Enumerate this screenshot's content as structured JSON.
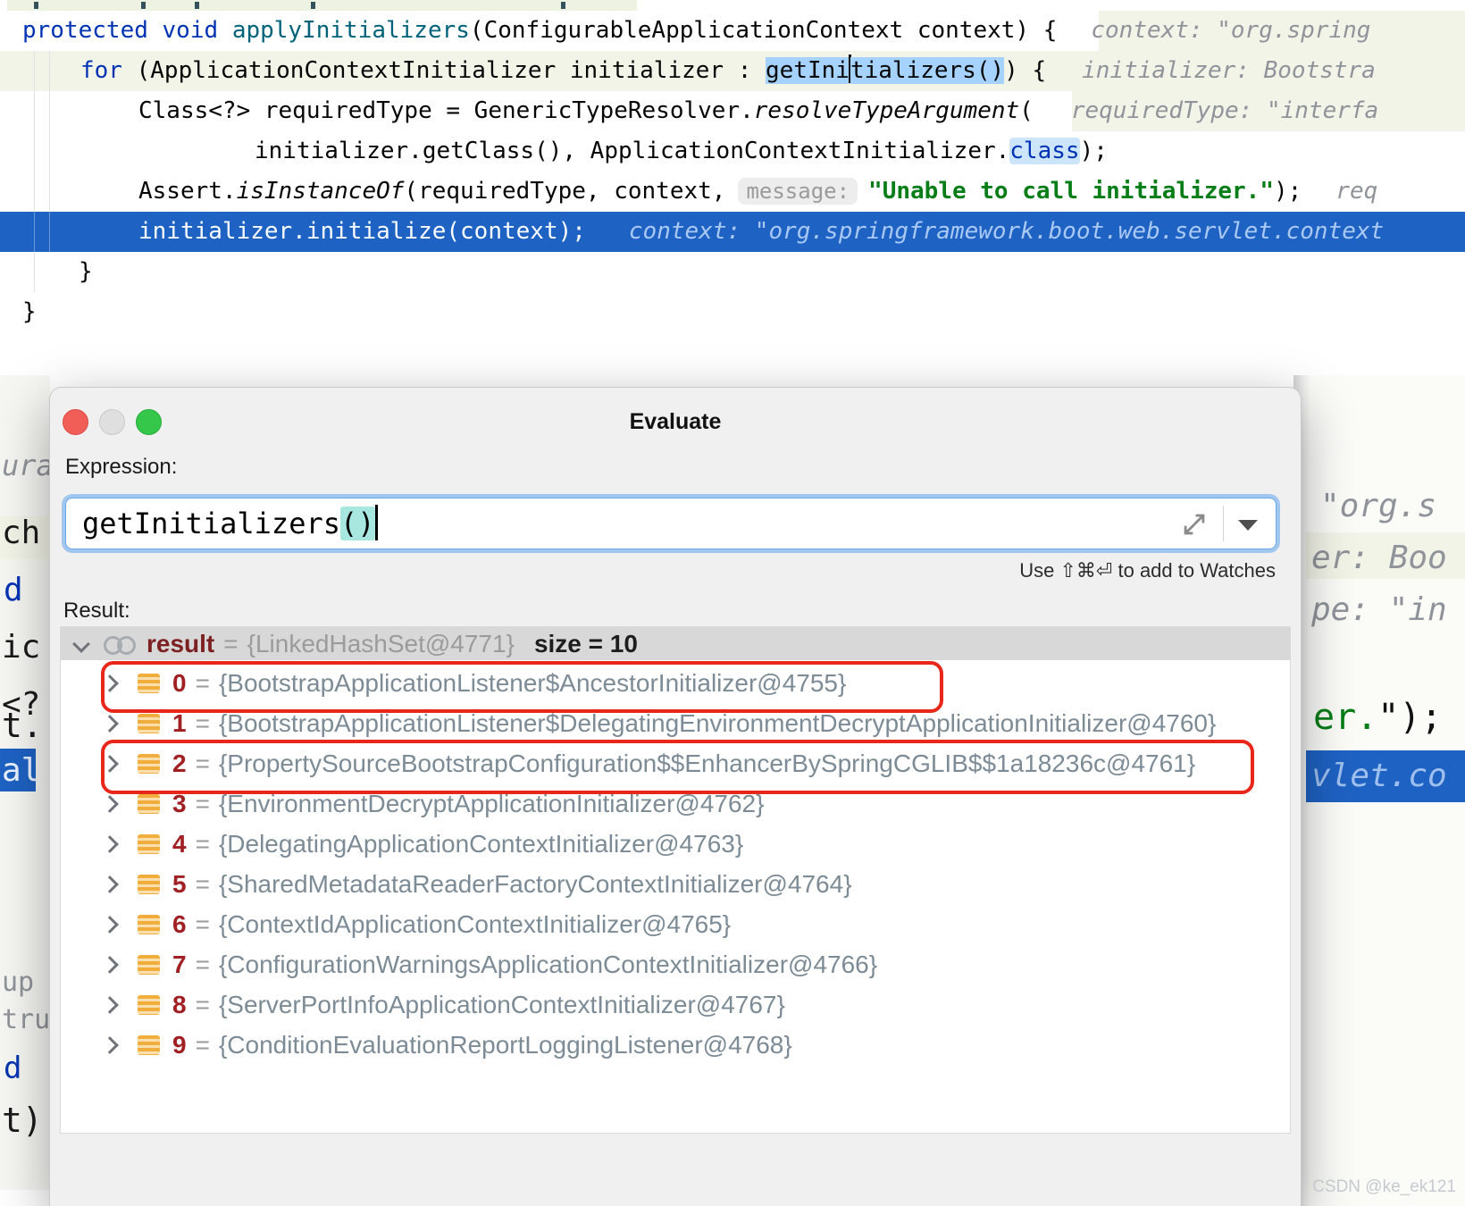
{
  "editor": {
    "line1": {
      "kw": "protected void ",
      "method": "applyInitializers",
      "code": "(ConfigurableApplicationContext context) {",
      "hint": "context: \"org.spring"
    },
    "line2": {
      "kw": "for",
      "code_a": " (ApplicationContextInitializer initializer : ",
      "sel_a": "getIni",
      "sel_b": "tializers()",
      "code_b": ") {",
      "hint": "initializer: Bootstra"
    },
    "line3": {
      "code_a": "Class<?> requiredType = GenericTypeResolver.",
      "method": "resolveTypeArgument",
      "code_b": "(",
      "hint": "requiredType: \"interfa"
    },
    "line4": {
      "code_a": "initializer.getClass(), ApplicationContextInitializer.",
      "kw": "class",
      "code_b": ");"
    },
    "line5": {
      "code_a": "Assert.",
      "method": "isInstanceOf",
      "code_b": "(requiredType, context,",
      "chip": "message:",
      "string": "\"Unable to call initializer.\"",
      "code_c": ");",
      "hint": "req"
    },
    "line6": {
      "code": "initializer.initialize(context);",
      "hint": "context: \"org.springframework.boot.web.servlet.context"
    },
    "line7": "}",
    "line8": "}"
  },
  "dialog": {
    "title": "Evaluate",
    "expression_label": "Expression:",
    "expression": {
      "text": "getInitializers",
      "parens": "()"
    },
    "watches_hint": "Use ⇧⌘⏎ to add to Watches",
    "result_label": "Result:",
    "eq": "=",
    "result_root": {
      "name": "result",
      "type": "{LinkedHashSet@4771}",
      "size": "size = 10"
    },
    "items": [
      {
        "index": "0",
        "value": "{BootstrapApplicationListener$AncestorInitializer@4755}",
        "boxed": true
      },
      {
        "index": "1",
        "value": "{BootstrapApplicationListener$DelegatingEnvironmentDecryptApplicationInitializer@4760}",
        "boxed": false
      },
      {
        "index": "2",
        "value": "{PropertySourceBootstrapConfiguration$$EnhancerBySpringCGLIB$$1a18236c@4761}",
        "boxed": true
      },
      {
        "index": "3",
        "value": "{EnvironmentDecryptApplicationInitializer@4762}",
        "boxed": false
      },
      {
        "index": "4",
        "value": "{DelegatingApplicationContextInitializer@4763}",
        "boxed": false
      },
      {
        "index": "5",
        "value": "{SharedMetadataReaderFactoryContextInitializer@4764}",
        "boxed": false
      },
      {
        "index": "6",
        "value": "{ContextIdApplicationContextInitializer@4765}",
        "boxed": false
      },
      {
        "index": "7",
        "value": "{ConfigurationWarningsApplicationContextInitializer@4766}",
        "boxed": false
      },
      {
        "index": "8",
        "value": "{ServerPortInfoApplicationContextInitializer@4767}",
        "boxed": false
      },
      {
        "index": "9",
        "value": "{ConditionEvaluationReportLoggingListener@4768}",
        "boxed": false
      }
    ]
  },
  "backdrop": {
    "left": {
      "f1": "ura",
      "f2": "ch",
      "f3": "d",
      "f4": "ic",
      "f5": "<?",
      "f6": "t.",
      "f7": "al",
      "f8": "up",
      "f9": "tru",
      "f10": "d",
      "f11": "t)"
    },
    "right": {
      "f1": "\"org.s",
      "f2": "er: Boo",
      "f3": "pe: \"in",
      "f4_green": "er.",
      "f4_rest": "\");",
      "f5": "vlet.co"
    }
  },
  "watermark": "CSDN @ke_ek121",
  "colors": {
    "keyword": "#0033B3",
    "method_decl": "#00627A",
    "string": "#067D17",
    "inline_hint": "#8F949B",
    "selection": "#A6D2FF",
    "execution_line": "#1E62C3",
    "annotation_red": "#E8261A",
    "tree_index": "#A02024",
    "tree_value": "#7C8B95",
    "result_name": "#7D2022"
  }
}
